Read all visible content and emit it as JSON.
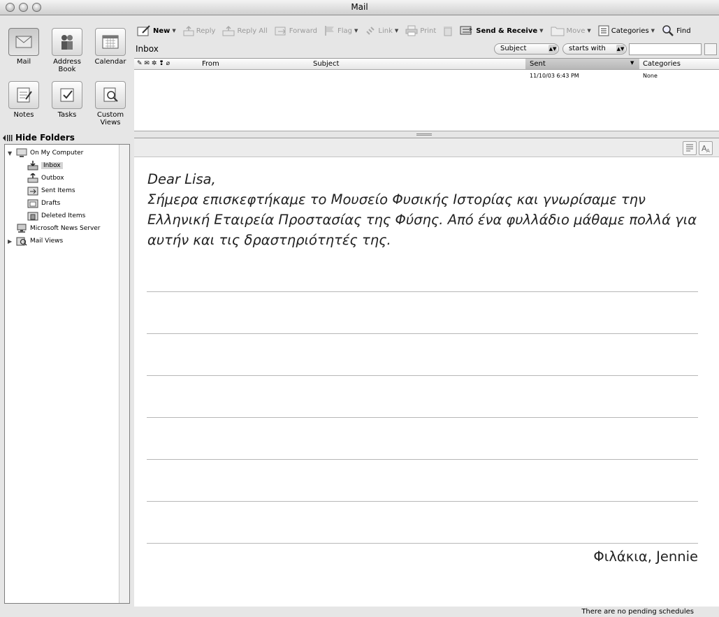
{
  "window": {
    "title": "Mail"
  },
  "modules": [
    {
      "label": "Mail",
      "icon": "mail-icon"
    },
    {
      "label": "Address Book",
      "icon": "address-book-icon"
    },
    {
      "label": "Calendar",
      "icon": "calendar-icon"
    },
    {
      "label": "Notes",
      "icon": "notes-icon"
    },
    {
      "label": "Tasks",
      "icon": "tasks-icon"
    },
    {
      "label": "Custom Views",
      "icon": "custom-views-icon"
    }
  ],
  "sidebar": {
    "hide_folders": "Hide Folders",
    "tree": [
      {
        "label": "On My Computer"
      },
      {
        "label": "Inbox"
      },
      {
        "label": "Outbox"
      },
      {
        "label": "Sent Items"
      },
      {
        "label": "Drafts"
      },
      {
        "label": "Deleted Items"
      },
      {
        "label": "Microsoft News Server"
      },
      {
        "label": "Mail Views"
      }
    ]
  },
  "toolbar": {
    "new": "New",
    "reply": "Reply",
    "reply_all": "Reply All",
    "forward": "Forward",
    "flag": "Flag",
    "link": "Link",
    "print": "Print",
    "send_receive": "Send & Receive",
    "move": "Move",
    "categories": "Categories",
    "find": "Find"
  },
  "inbox": {
    "title": "Inbox",
    "filter_field": "Subject",
    "filter_mode": "starts with",
    "search_value": ""
  },
  "message_list": {
    "columns": {
      "from": "From",
      "subject": "Subject",
      "sent": "Sent",
      "categories": "Categories"
    },
    "rows": [
      {
        "from": "",
        "subject": "",
        "sent": "11/10/03 6:43 PM",
        "categories": "None"
      }
    ]
  },
  "preview": {
    "greeting": "Dear Lisa,",
    "body": "Σήμερα επισκεφτήκαμε το Μουσείο Φυσικής Ιστορίας και γνωρίσαμε την Ελληνική Εταιρεία Προστασίας της Φύσης.  Από ένα φυλλάδιο μάθαμε πολλά για αυτήν και τις δραστηριότητές της.",
    "signoff": "Φιλάκια, Jennie"
  },
  "status": {
    "text": "There are no pending schedules"
  }
}
